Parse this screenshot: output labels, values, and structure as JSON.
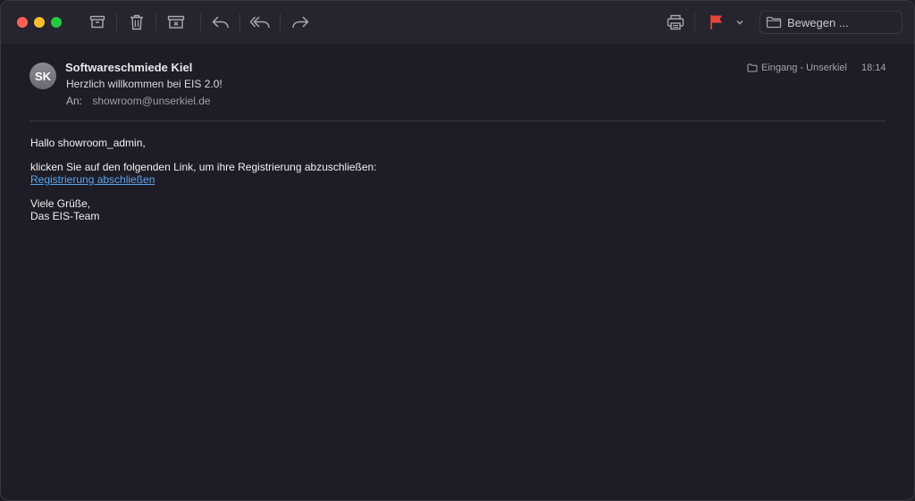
{
  "toolbar": {
    "buttons": [
      "archive-icon",
      "trash-icon",
      "junk-icon",
      "reply-icon",
      "reply-all-icon",
      "forward-icon",
      "print-icon",
      "flag-icon"
    ],
    "flag_color": "#e5443a",
    "move_label": "Bewegen ..."
  },
  "message": {
    "avatar_initials": "SK",
    "sender": "Softwareschmiede Kiel",
    "subject": "Herzlich willkommen bei EIS 2.0!",
    "to_label": "An:",
    "to_address": "showroom@unserkiel.de",
    "mailbox": "Eingang - Unserkiel",
    "time": "18:14"
  },
  "body": {
    "greeting": "Hallo showroom_admin,",
    "line1": "klicken Sie auf den folgenden Link, um ihre Registrierung abzuschließen:",
    "link_text": "Registrierung abschließen ",
    "closing1": "Viele Grüße,",
    "closing2": "Das EIS-Team"
  },
  "colors": {
    "background": "#1e1c26",
    "toolbar": "#26242e",
    "link": "#5aa6f0"
  }
}
